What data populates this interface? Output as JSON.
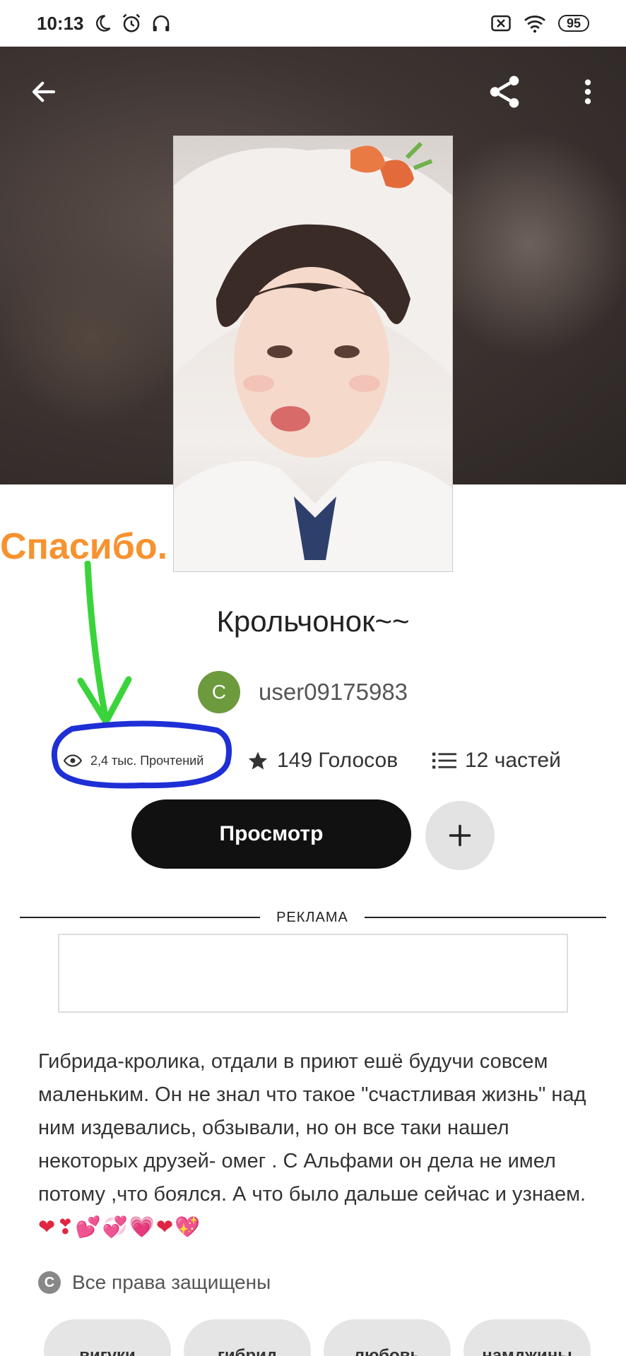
{
  "status_bar": {
    "time": "10:13",
    "battery": "95",
    "icons": [
      "moon-icon",
      "alarm-icon",
      "headphones-icon",
      "sim-x-icon",
      "wifi-icon",
      "battery-icon"
    ]
  },
  "toolbar": {
    "back_icon": "arrow-left-icon",
    "share_icon": "share-icon",
    "more_icon": "more-vertical-icon"
  },
  "annotation": {
    "text": "Спасибо.",
    "text_color": "#f7922f",
    "arrow_color": "#3ad43a",
    "circle_color": "#1f2fd6"
  },
  "story": {
    "title": "Крольчонок~~",
    "author_initial": "C",
    "author_name": "user09175983",
    "avatar_color": "#6c9a3d"
  },
  "stats": {
    "reads": "2,4 тыс. Прочтений",
    "votes": "149 Голосов",
    "parts": "12 частей"
  },
  "actions": {
    "view_label": "Просмотр",
    "add_label": "+"
  },
  "ad": {
    "label": "РЕКЛАМА"
  },
  "description": {
    "text": "Гибрида-кролика, отдали в приют ешё будучи совсем маленьким. Он не знал что такое \"счастливая жизнь\" над ним издевались, обзывали, но он все таки нашел некоторых друзей- омег . С Альфами он дела не имел потому ,что боялся. А что было дальше сейчас и узнаем.",
    "emojis": "❤❣💕💞💗❤💖"
  },
  "copyright": {
    "label": "Все права защищены"
  },
  "tags": [
    "вигуки",
    "гибрид",
    "любовь",
    "намджины"
  ]
}
